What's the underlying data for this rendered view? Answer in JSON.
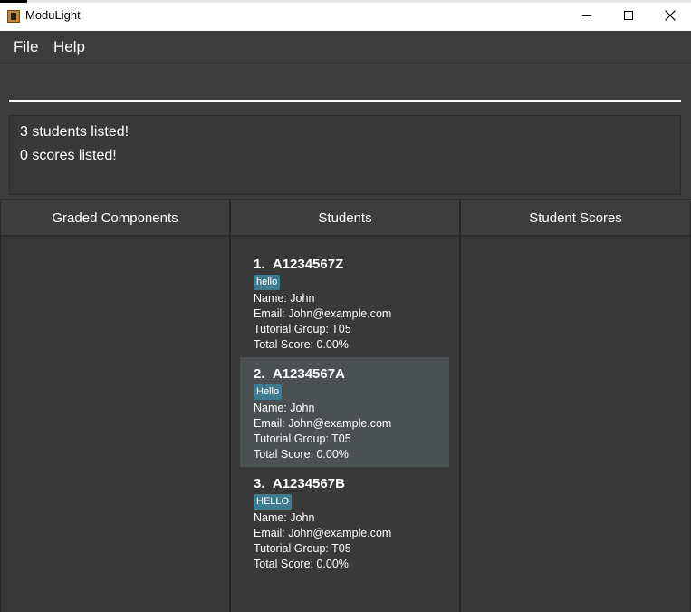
{
  "window": {
    "title": "ModuLight",
    "minimize_icon": "minimize-icon",
    "maximize_icon": "maximize-icon",
    "close_icon": "close-icon"
  },
  "menubar": {
    "items": [
      {
        "label": "File"
      },
      {
        "label": "Help"
      }
    ]
  },
  "command": {
    "value": "",
    "placeholder": ""
  },
  "result": {
    "lines": [
      "3 students listed!",
      "0 scores listed!"
    ]
  },
  "panels": {
    "graded_components": {
      "title": "Graded Components"
    },
    "students": {
      "title": "Students"
    },
    "student_scores": {
      "title": "Student Scores"
    }
  },
  "students": [
    {
      "index": "1.",
      "id": "A1234567Z",
      "tag": "hello",
      "name": "Name: John",
      "email": "Email: John@example.com",
      "tutorial": "Tutorial Group: T05",
      "score": "Total Score: 0.00%"
    },
    {
      "index": "2.",
      "id": "A1234567A",
      "tag": "Hello",
      "name": "Name: John",
      "email": "Email: John@example.com",
      "tutorial": "Tutorial Group: T05",
      "score": "Total Score: 0.00%"
    },
    {
      "index": "3.",
      "id": "A1234567B",
      "tag": "HELLO",
      "name": "Name: John",
      "email": "Email: John@example.com",
      "tutorial": "Tutorial Group: T05",
      "score": "Total Score: 0.00%"
    }
  ],
  "colors": {
    "background": "#3c3c3c",
    "tag": "#3e7b91",
    "selected_card": "#4b5052"
  }
}
